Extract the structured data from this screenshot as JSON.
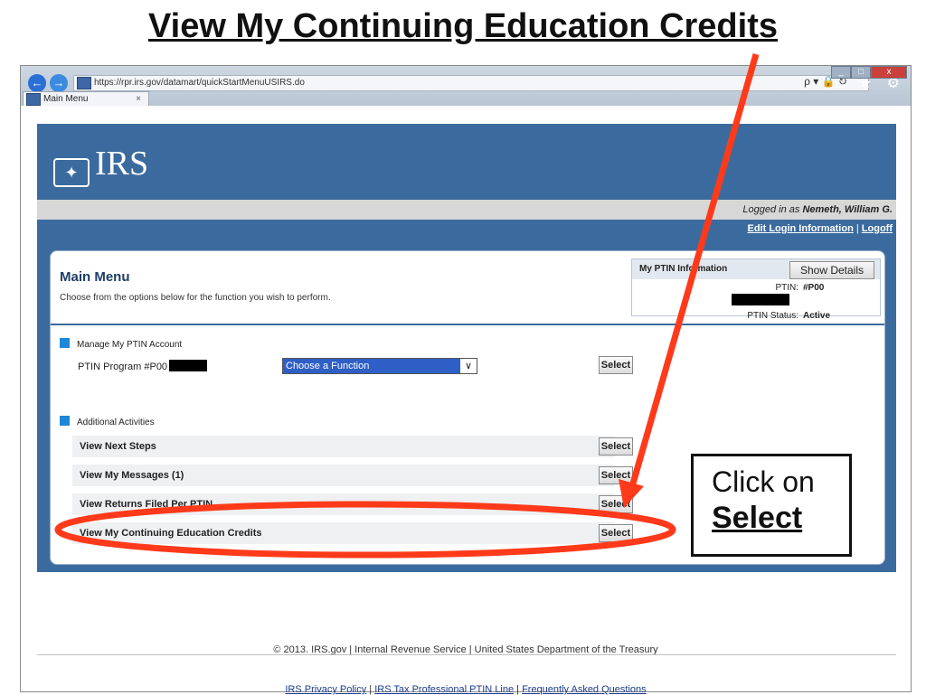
{
  "slide_title": "View My Continuing Education Credits",
  "browser": {
    "url": "https://rpr.irs.gov/datamart/quickStartMenuUSIRS.do",
    "tab_label": "Main Menu",
    "tab_close": "×",
    "address_controls": "ρ ▾ 🔒 ↻",
    "toolbar_icons": "⌂ ★ ⚙",
    "window_controls": [
      "_",
      "□",
      "x"
    ],
    "back_icon": "arrow-left-icon",
    "forward_icon": "arrow-right-icon"
  },
  "header": {
    "logo_text": "IRS",
    "logged_in_prefix": "Logged in as",
    "user_name": "Nemeth, William G.",
    "edit_login": "Edit Login Information",
    "separator": "|",
    "logoff": "Logoff"
  },
  "main_menu": {
    "title": "Main Menu",
    "subtitle": "Choose from the options below for the function you wish to perform."
  },
  "ptin_info": {
    "heading": "My PTIN Information",
    "show_details": "Show Details",
    "ptin_label": "PTIN:",
    "ptin_value": "#P00",
    "status_label": "PTIN Status:",
    "status_value": "Active"
  },
  "manage": {
    "section_label": "Manage My PTIN Account",
    "program_label": "PTIN Program",
    "program_value": "#P00",
    "function_select": "Choose a Function",
    "select_label": "Select"
  },
  "additional": {
    "section_label": "Additional Activities",
    "rows": [
      {
        "label": "View Next Steps",
        "button": "Select"
      },
      {
        "label": "View My Messages  (1)",
        "button": "Select"
      },
      {
        "label": "View Returns Filed Per PTIN",
        "button": "Select"
      },
      {
        "label": "View My Continuing Education Credits",
        "button": "Select"
      }
    ]
  },
  "footer": {
    "copyright": "© 2013. IRS.gov | Internal Revenue Service | United States Department of the Treasury",
    "links": [
      "IRS Privacy Policy",
      "IRS Tax Professional PTIN Line",
      "Frequently Asked Questions"
    ],
    "link_separator": " | "
  },
  "callout": {
    "line1": "Click on",
    "line2": "Select"
  },
  "colors": {
    "irs_blue": "#3b6b9e",
    "annotation_red": "#ff3a1a",
    "section_square": "#1e88d8"
  }
}
